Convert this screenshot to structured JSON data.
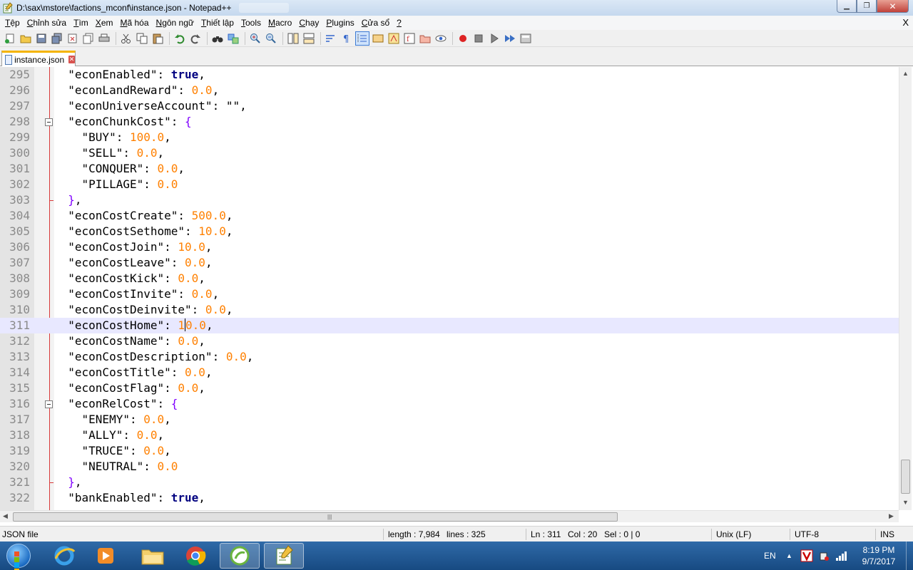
{
  "window": {
    "title": "D:\\sax\\mstore\\factions_mconf\\instance.json - Notepad++"
  },
  "menu": [
    {
      "label": "Tệp",
      "u": "T",
      "rest": "ệp"
    },
    {
      "label": "Chỉnh sửa",
      "u": "C",
      "rest": "hỉnh sửa"
    },
    {
      "label": "Tìm",
      "u": "T",
      "rest": "ìm"
    },
    {
      "label": "Xem",
      "u": "X",
      "rest": "em"
    },
    {
      "label": "Mã hóa",
      "u": "M",
      "rest": "ã hóa"
    },
    {
      "label": "Ngôn ngữ",
      "u": "N",
      "rest": "gôn ngữ"
    },
    {
      "label": "Thiết lập",
      "u": "T",
      "rest": "hiết lập"
    },
    {
      "label": "Tools",
      "u": "T",
      "rest": "ools"
    },
    {
      "label": "Macro",
      "u": "M",
      "rest": "acro"
    },
    {
      "label": "Chạy",
      "u": "C",
      "rest": "hạy"
    },
    {
      "label": "Plugins",
      "u": "P",
      "rest": "lugins"
    },
    {
      "label": "Cửa sổ",
      "u": "C",
      "rest": "ửa sổ"
    },
    {
      "label": "?",
      "u": "?",
      "rest": ""
    }
  ],
  "menu_close": "X",
  "tab": {
    "label": "instance.json"
  },
  "editor": {
    "lines": [
      {
        "n": "295",
        "parts": [
          [
            "k",
            "  \"econEnabled\""
          ],
          [
            "p",
            ": "
          ],
          [
            "b",
            "true"
          ],
          [
            "p",
            ","
          ]
        ]
      },
      {
        "n": "296",
        "parts": [
          [
            "k",
            "  \"econLandReward\""
          ],
          [
            "p",
            ": "
          ],
          [
            "n",
            "0.0"
          ],
          [
            "p",
            ","
          ]
        ]
      },
      {
        "n": "297",
        "parts": [
          [
            "k",
            "  \"econUniverseAccount\""
          ],
          [
            "p",
            ": "
          ],
          [
            "k",
            "\"\""
          ],
          [
            "p",
            ","
          ]
        ]
      },
      {
        "n": "298",
        "fold": true,
        "parts": [
          [
            "k",
            "  \"econChunkCost\""
          ],
          [
            "p",
            ": "
          ],
          [
            "d",
            "{"
          ]
        ]
      },
      {
        "n": "299",
        "parts": [
          [
            "k",
            "    \"BUY\""
          ],
          [
            "p",
            ": "
          ],
          [
            "n",
            "100.0"
          ],
          [
            "p",
            ","
          ]
        ]
      },
      {
        "n": "300",
        "parts": [
          [
            "k",
            "    \"SELL\""
          ],
          [
            "p",
            ": "
          ],
          [
            "n",
            "0.0"
          ],
          [
            "p",
            ","
          ]
        ]
      },
      {
        "n": "301",
        "parts": [
          [
            "k",
            "    \"CONQUER\""
          ],
          [
            "p",
            ": "
          ],
          [
            "n",
            "0.0"
          ],
          [
            "p",
            ","
          ]
        ]
      },
      {
        "n": "302",
        "parts": [
          [
            "k",
            "    \"PILLAGE\""
          ],
          [
            "p",
            ": "
          ],
          [
            "n",
            "0.0"
          ]
        ]
      },
      {
        "n": "303",
        "foldend": true,
        "parts": [
          [
            "d",
            "  }"
          ],
          [
            "p",
            ","
          ]
        ]
      },
      {
        "n": "304",
        "parts": [
          [
            "k",
            "  \"econCostCreate\""
          ],
          [
            "p",
            ": "
          ],
          [
            "n",
            "500.0"
          ],
          [
            "p",
            ","
          ]
        ]
      },
      {
        "n": "305",
        "parts": [
          [
            "k",
            "  \"econCostSethome\""
          ],
          [
            "p",
            ": "
          ],
          [
            "n",
            "10.0"
          ],
          [
            "p",
            ","
          ]
        ]
      },
      {
        "n": "306",
        "parts": [
          [
            "k",
            "  \"econCostJoin\""
          ],
          [
            "p",
            ": "
          ],
          [
            "n",
            "10.0"
          ],
          [
            "p",
            ","
          ]
        ]
      },
      {
        "n": "307",
        "parts": [
          [
            "k",
            "  \"econCostLeave\""
          ],
          [
            "p",
            ": "
          ],
          [
            "n",
            "0.0"
          ],
          [
            "p",
            ","
          ]
        ]
      },
      {
        "n": "308",
        "parts": [
          [
            "k",
            "  \"econCostKick\""
          ],
          [
            "p",
            ": "
          ],
          [
            "n",
            "0.0"
          ],
          [
            "p",
            ","
          ]
        ]
      },
      {
        "n": "309",
        "parts": [
          [
            "k",
            "  \"econCostInvite\""
          ],
          [
            "p",
            ": "
          ],
          [
            "n",
            "0.0"
          ],
          [
            "p",
            ","
          ]
        ]
      },
      {
        "n": "310",
        "parts": [
          [
            "k",
            "  \"econCostDeinvite\""
          ],
          [
            "p",
            ": "
          ],
          [
            "n",
            "0.0"
          ],
          [
            "p",
            ","
          ]
        ]
      },
      {
        "n": "311",
        "current": true,
        "parts": [
          [
            "k",
            "  \"econCostHome\""
          ],
          [
            "p",
            ": "
          ],
          [
            "n",
            "1"
          ],
          [
            "caret",
            ""
          ],
          [
            "n",
            "0.0"
          ],
          [
            "p",
            ","
          ]
        ]
      },
      {
        "n": "312",
        "parts": [
          [
            "k",
            "  \"econCostName\""
          ],
          [
            "p",
            ": "
          ],
          [
            "n",
            "0.0"
          ],
          [
            "p",
            ","
          ]
        ]
      },
      {
        "n": "313",
        "parts": [
          [
            "k",
            "  \"econCostDescription\""
          ],
          [
            "p",
            ": "
          ],
          [
            "n",
            "0.0"
          ],
          [
            "p",
            ","
          ]
        ]
      },
      {
        "n": "314",
        "parts": [
          [
            "k",
            "  \"econCostTitle\""
          ],
          [
            "p",
            ": "
          ],
          [
            "n",
            "0.0"
          ],
          [
            "p",
            ","
          ]
        ]
      },
      {
        "n": "315",
        "parts": [
          [
            "k",
            "  \"econCostFlag\""
          ],
          [
            "p",
            ": "
          ],
          [
            "n",
            "0.0"
          ],
          [
            "p",
            ","
          ]
        ]
      },
      {
        "n": "316",
        "fold": true,
        "parts": [
          [
            "k",
            "  \"econRelCost\""
          ],
          [
            "p",
            ": "
          ],
          [
            "d",
            "{"
          ]
        ]
      },
      {
        "n": "317",
        "parts": [
          [
            "k",
            "    \"ENEMY\""
          ],
          [
            "p",
            ": "
          ],
          [
            "n",
            "0.0"
          ],
          [
            "p",
            ","
          ]
        ]
      },
      {
        "n": "318",
        "parts": [
          [
            "k",
            "    \"ALLY\""
          ],
          [
            "p",
            ": "
          ],
          [
            "n",
            "0.0"
          ],
          [
            "p",
            ","
          ]
        ]
      },
      {
        "n": "319",
        "parts": [
          [
            "k",
            "    \"TRUCE\""
          ],
          [
            "p",
            ": "
          ],
          [
            "n",
            "0.0"
          ],
          [
            "p",
            ","
          ]
        ]
      },
      {
        "n": "320",
        "parts": [
          [
            "k",
            "    \"NEUTRAL\""
          ],
          [
            "p",
            ": "
          ],
          [
            "n",
            "0.0"
          ]
        ]
      },
      {
        "n": "321",
        "foldend": true,
        "parts": [
          [
            "d",
            "  }"
          ],
          [
            "p",
            ","
          ]
        ]
      },
      {
        "n": "322",
        "parts": [
          [
            "k",
            "  \"bankEnabled\""
          ],
          [
            "p",
            ": "
          ],
          [
            "b",
            "true"
          ],
          [
            "p",
            ","
          ]
        ]
      }
    ]
  },
  "status": {
    "file_type": "JSON file",
    "length": "length : 7,984",
    "lines": "lines : 325",
    "ln": "Ln : 311",
    "col": "Col : 20",
    "sel": "Sel : 0 | 0",
    "eol": "Unix (LF)",
    "encoding": "UTF-8",
    "mode": "INS"
  },
  "taskbar": {
    "language": "EN",
    "time": "8:19 PM",
    "date": "9/7/2017"
  }
}
